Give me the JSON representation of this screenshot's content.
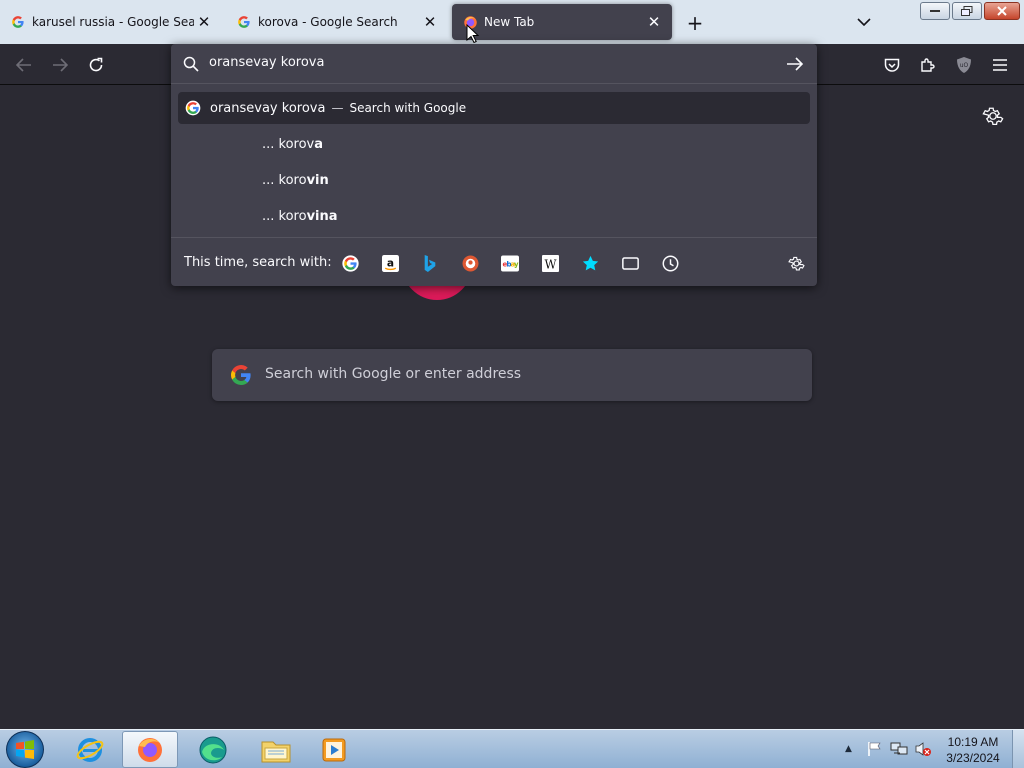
{
  "tabs": [
    {
      "title": "karusel russia - Google Search",
      "favicon": "google-icon",
      "active": false
    },
    {
      "title": "korova - Google Search",
      "favicon": "google-icon",
      "active": false
    },
    {
      "title": "New Tab",
      "favicon": "firefox-icon",
      "active": true
    }
  ],
  "urlbar": {
    "value": "oransevay korova",
    "heuristic": {
      "text": "oransevay korova",
      "separator": "—",
      "action": "Search with Google"
    },
    "suggestions": [
      {
        "prefix": "... korov",
        "bold": "a"
      },
      {
        "prefix": "... koro",
        "bold": "vin"
      },
      {
        "prefix": "... koro",
        "bold": "vina"
      }
    ],
    "oneoff_label": "This time, search with:",
    "engines": [
      "google-icon",
      "amazon-icon",
      "bing-icon",
      "duckduckgo-icon",
      "ebay-icon",
      "wikipedia-icon",
      "bookmarks-icon",
      "tabs-icon",
      "history-icon"
    ]
  },
  "ntp": {
    "search_placeholder": "Search with Google or enter address"
  },
  "taskbar": {
    "time": "10:19 AM",
    "date": "3/23/2024",
    "apps": [
      "internet-explorer-icon",
      "firefox-icon",
      "edge-icon",
      "file-explorer-icon",
      "media-player-icon"
    ]
  },
  "colors": {
    "page_bg": "#2b2a33",
    "panel_bg": "#42414d",
    "tabstrip_bg": "#dbe5ef"
  }
}
